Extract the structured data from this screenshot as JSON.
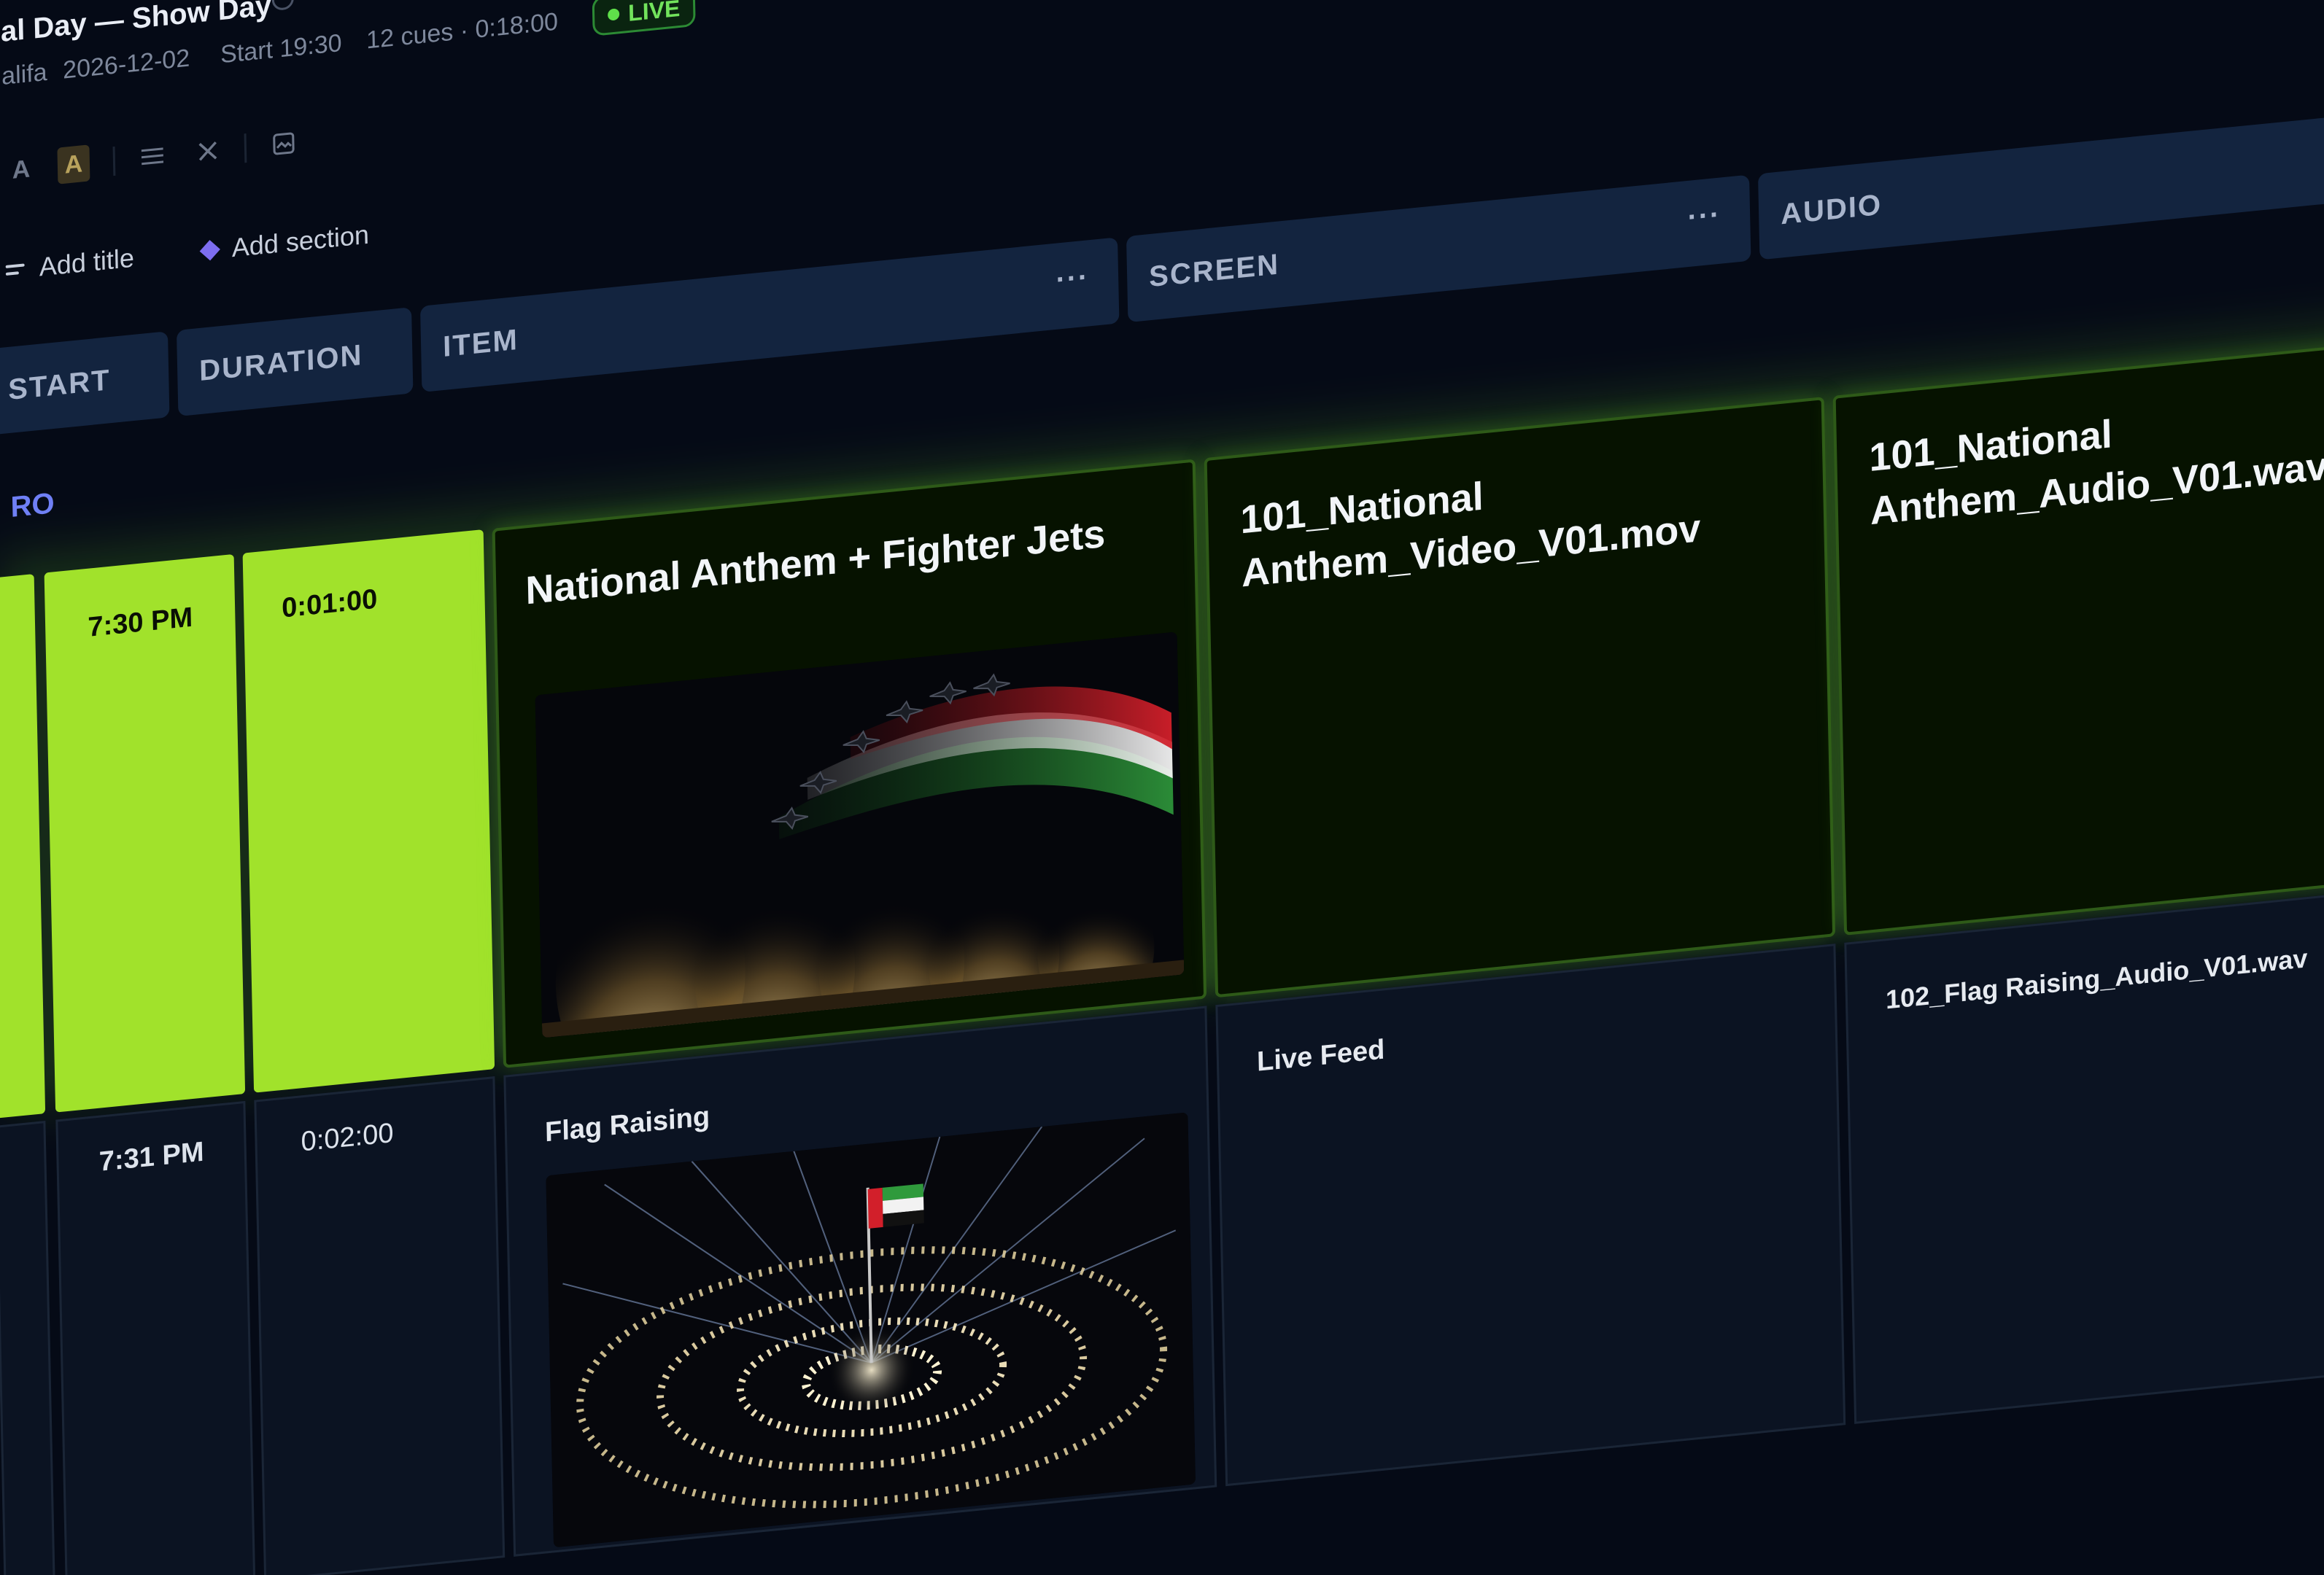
{
  "header": {
    "title": "al Day — Show Day",
    "venue": "alifa",
    "date": "2026-12-02",
    "start": "Start 19:30",
    "cues": "12 cues · 0:18:00",
    "live_label": "LIVE"
  },
  "toolbar": {
    "font_a": "A",
    "font_a_highlight": "A",
    "list_icon": "list-icon",
    "close_icon": "close-icon",
    "image_icon": "image-icon"
  },
  "actions": {
    "add_title": "Add title",
    "add_section": "Add section"
  },
  "columns": {
    "start": "START",
    "duration": "DURATION",
    "item": "ITEM",
    "screen": "SCREEN",
    "audio": "AUDIO",
    "more_label": "..."
  },
  "section": {
    "label": "RO"
  },
  "rows": [
    {
      "start": "7:30 PM",
      "duration": "0:01:00",
      "item": "National Anthem + Fighter Jets",
      "screen": "101_National Anthem_Video_V01.mov",
      "audio": "101_National Anthem_Audio_V01.wav",
      "state": "live"
    },
    {
      "start": "7:31 PM",
      "duration": "0:02:00",
      "item": "Flag Raising",
      "screen": "Live Feed",
      "audio": "102_Flag Raising_Audio_V01.wav",
      "state": "next"
    }
  ],
  "colors": {
    "live_green": "#a1e22b",
    "header_blue": "#13243f",
    "section_purple": "#6f7ff5",
    "background": "#050a16"
  }
}
